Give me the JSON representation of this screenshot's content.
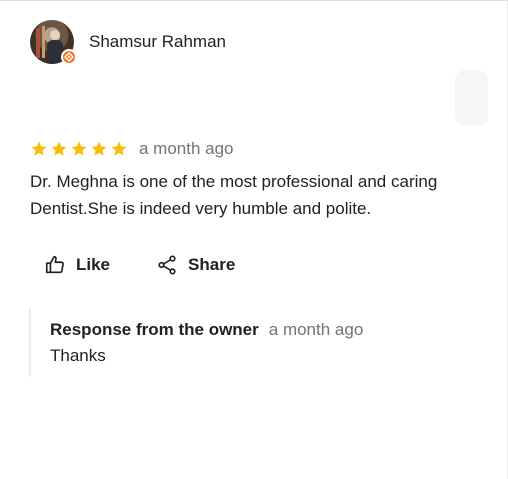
{
  "reviewer": {
    "name": "Shamsur Rahman",
    "badge_icon": "local-guide-badge-icon",
    "badge_color": "#f36f23"
  },
  "review": {
    "rating": 5,
    "max_rating": 5,
    "star_color": "#fbbc04",
    "date": "a month ago",
    "text": "Dr. Meghna is one of the most professional and caring Dentist.She is indeed very humble and polite."
  },
  "actions": {
    "like_label": "Like",
    "share_label": "Share"
  },
  "owner_response": {
    "title": "Response from the owner",
    "date": "a month ago",
    "text": "Thanks"
  }
}
